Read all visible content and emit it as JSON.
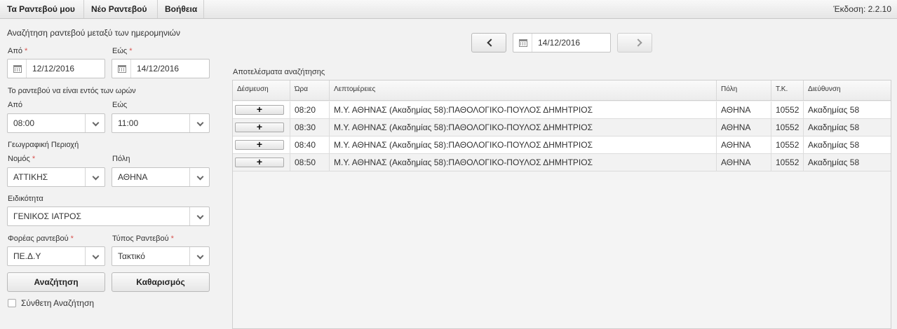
{
  "menu": {
    "items": [
      "Τα Ραντεβού μου",
      "Νέο Ραντεβού",
      "Βοήθεια"
    ],
    "version": "Έκδοση: 2.2.10"
  },
  "search": {
    "heading": "Αναζήτηση ραντεβού μεταξύ των ημερομηνιών",
    "from_label": "Από",
    "from_date": "12/12/2016",
    "to_label": "Εώς",
    "to_date": "14/12/2016",
    "hours_heading": "Το ραντεβού να είναι εντός των ωρών",
    "hour_from_label": "Από",
    "hour_from": "08:00",
    "hour_to_label": "Εώς",
    "hour_to": "11:00",
    "region_heading": "Γεωγραφική Περιοχή",
    "prefecture_label": "Νομός",
    "prefecture": "ΑΤΤΙΚΗΣ",
    "city_label": "Πόλη",
    "city": "ΑΘΗΝΑ",
    "specialty_label": "Ειδικότητα",
    "specialty": "ΓΕΝΙΚΟΣ ΙΑΤΡΟΣ",
    "provider_label": "Φορέας ραντεβού",
    "provider": "ΠΕ.Δ.Υ",
    "type_label": "Τύπος Ραντεβού",
    "type": "Τακτικό",
    "search_button": "Αναζήτηση",
    "clear_button": "Καθαρισμός",
    "advanced_label": "Σύνθετη Αναζήτηση",
    "required_mark": "*"
  },
  "nav": {
    "current_date": "14/12/2016"
  },
  "results": {
    "title": "Αποτελέσματα αναζήτησης",
    "columns": [
      "Δέσμευση",
      "Ώρα",
      "Λεπτομέρειες",
      "Πόλη",
      "Τ.Κ.",
      "Διεύθυνση"
    ],
    "book_label": "+",
    "rows": [
      {
        "time": "08:20",
        "details": "Μ.Υ. ΑΘΗΝΑΣ (Ακαδημίας 58):ΠΑΘΟΛΟΓΙΚΟ-ΠΟΥΛΟΣ ΔΗΜΗΤΡΙΟΣ",
        "city": "ΑΘΗΝΑ",
        "zip": "10552",
        "address": "Ακαδημίας 58"
      },
      {
        "time": "08:30",
        "details": "Μ.Υ. ΑΘΗΝΑΣ (Ακαδημίας 58):ΠΑΘΟΛΟΓΙΚΟ-ΠΟΥΛΟΣ ΔΗΜΗΤΡΙΟΣ",
        "city": "ΑΘΗΝΑ",
        "zip": "10552",
        "address": "Ακαδημίας 58"
      },
      {
        "time": "08:40",
        "details": "Μ.Υ. ΑΘΗΝΑΣ (Ακαδημίας 58):ΠΑΘΟΛΟΓΙΚΟ-ΠΟΥΛΟΣ ΔΗΜΗΤΡΙΟΣ",
        "city": "ΑΘΗΝΑ",
        "zip": "10552",
        "address": "Ακαδημίας 58"
      },
      {
        "time": "08:50",
        "details": "Μ.Υ. ΑΘΗΝΑΣ (Ακαδημίας 58):ΠΑΘΟΛΟΓΙΚΟ-ΠΟΥΛΟΣ ΔΗΜΗΤΡΙΟΣ",
        "city": "ΑΘΗΝΑ",
        "zip": "10552",
        "address": "Ακαδημίας 58"
      }
    ]
  },
  "colors": {
    "required": "#d9534f",
    "menu_bg": "#eeeeee",
    "page_bg": "#f2f2f2"
  }
}
